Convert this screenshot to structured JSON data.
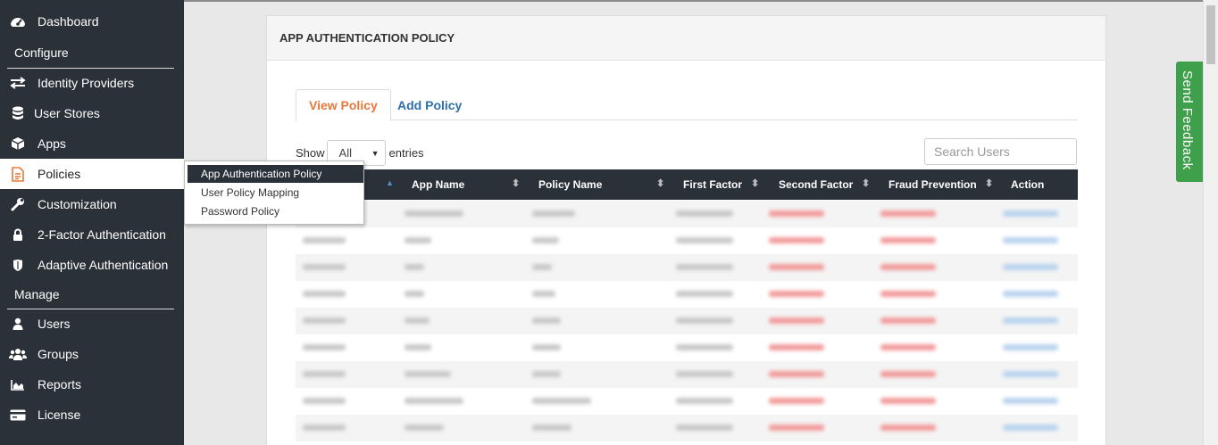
{
  "sidebar": {
    "dashboard": "Dashboard",
    "configure": "Configure",
    "identity_providers": "Identity Providers",
    "user_stores": "User Stores",
    "apps": "Apps",
    "policies": "Policies",
    "customization": "Customization",
    "two_factor": "2-Factor Authentication",
    "adaptive": "Adaptive Authentication",
    "manage": "Manage",
    "users": "Users",
    "groups": "Groups",
    "reports": "Reports",
    "license": "License"
  },
  "policies_menu": {
    "item1": "App Authentication Policy",
    "item2": "User Policy Mapping",
    "item3": "Password Policy"
  },
  "card": {
    "title": "APP AUTHENTICATION POLICY",
    "tab_view": "View Policy",
    "tab_add": "Add Policy",
    "show_label": "Show",
    "entries_value": "All",
    "entries_label": "entries",
    "search_placeholder": "Search Users"
  },
  "table": {
    "columns": [
      "App Name",
      "Policy Name",
      "First Factor",
      "Second Factor",
      "Fraud Prevention",
      "Action"
    ]
  },
  "feedback_label": "Send Feedback",
  "colors": {
    "sidebar_bg": "#2b3138",
    "active_tab": "#e8783a",
    "link": "#2f6fab",
    "feedback": "#3ea04a"
  }
}
